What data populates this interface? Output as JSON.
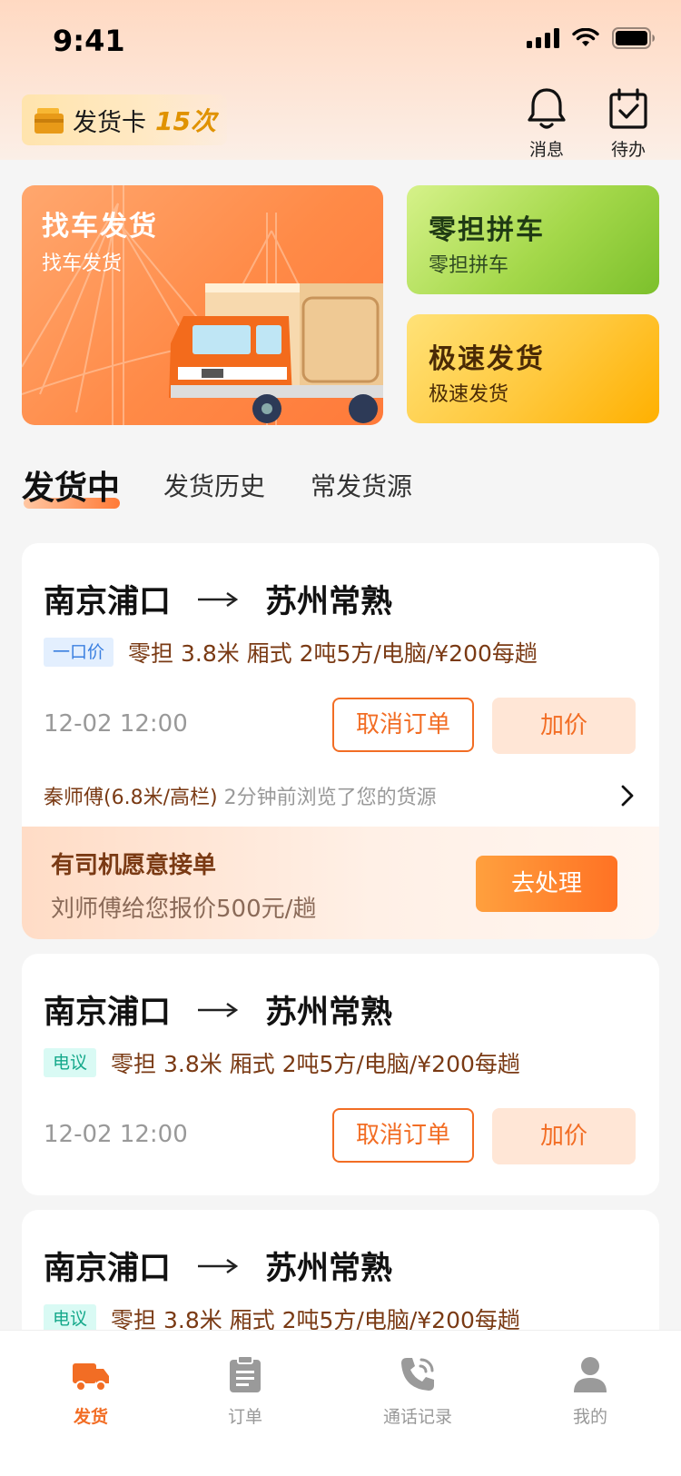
{
  "status_bar": {
    "time": "9:41"
  },
  "header": {
    "card_label": "发货卡",
    "card_count": "15次",
    "message_label": "消息",
    "todo_label": "待办"
  },
  "banners": {
    "find_truck": {
      "title": "找车发货",
      "subtitle": "找车发货"
    },
    "ltl": {
      "title": "零担拼车",
      "subtitle": "零担拼车"
    },
    "express": {
      "title": "极速发货",
      "subtitle": "极速发货"
    }
  },
  "tabs": [
    {
      "label": "发货中",
      "active": true
    },
    {
      "label": "发货历史",
      "active": false
    },
    {
      "label": "常发货源",
      "active": false
    }
  ],
  "orders": [
    {
      "from": "南京浦口",
      "to": "苏州常熟",
      "tag": "一口价",
      "detail": "零担 3.8米 厢式 2吨5方/电脑/¥200每趟",
      "date": "12-02 12:00",
      "cancel_label": "取消订单",
      "raise_label": "加价",
      "viewer_name": "秦师傅(6.8米/高栏)",
      "viewer_action": "2分钟前浏览了您的货源",
      "driver_title": "有司机愿意接单",
      "driver_offer": "刘师傅给您报价500元/趟",
      "handle_label": "去处理"
    },
    {
      "from": "南京浦口",
      "to": "苏州常熟",
      "tag": "电议",
      "detail": "零担 3.8米 厢式 2吨5方/电脑/¥200每趟",
      "date": "12-02 12:00",
      "cancel_label": "取消订单",
      "raise_label": "加价"
    },
    {
      "from": "南京浦口",
      "to": "苏州常熟",
      "tag": "电议",
      "detail": "零担 3.8米 厢式 2吨5方/电脑/¥200每趟"
    }
  ],
  "tab_bar": [
    {
      "label": "发货",
      "icon": "truck-icon",
      "active": true
    },
    {
      "label": "订单",
      "icon": "clipboard-icon",
      "active": false
    },
    {
      "label": "通话记录",
      "icon": "phone-icon",
      "active": false
    },
    {
      "label": "我的",
      "icon": "person-icon",
      "active": false
    }
  ],
  "colors": {
    "accent": "#f26d24",
    "brown_text": "#7a3a14",
    "tag_blue": "#3a7fe0",
    "tag_cyan": "#14a88a"
  }
}
